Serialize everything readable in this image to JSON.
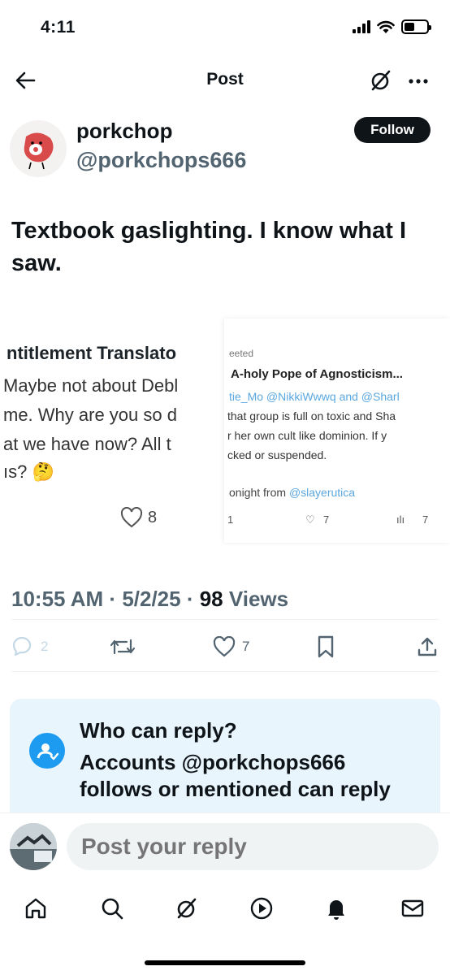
{
  "status_bar": {
    "time": "4:11"
  },
  "header": {
    "title": "Post"
  },
  "author": {
    "name": "porkchop",
    "handle": "@porkchops666",
    "follow_label": "Follow"
  },
  "tweet": {
    "text": "Textbook gaslighting. I know what I saw."
  },
  "media": {
    "left": {
      "line1": "ntitlement Translato",
      "line2": "Maybe not about Debl",
      "line3": "me. Why are you so d",
      "line4": "at we have now? All t",
      "line5": "ıs? 🤔",
      "like_count": "8"
    },
    "right": {
      "retweeted": "eeted",
      "name": "A-holy Pope of Agnosticism...",
      "mentions": "tie_Mo @NikkiWwwq and @Sharl",
      "line1": "that group is full on toxic and Sha",
      "line2": "r her own cult like dominion. If y",
      "line3": "cked or suspended.",
      "footer_prefix": "onight from ",
      "footer_handle": "@slayerutica",
      "reply_count": "1",
      "like_count": "7",
      "views_count": "7"
    }
  },
  "meta": {
    "time": "10:55 AM",
    "date": "5/2/25",
    "views_count": "98",
    "views_label": "Views"
  },
  "actions": {
    "replies": "2",
    "likes": "7"
  },
  "reply_box": {
    "title": "Who can reply?",
    "description": "Accounts @porkchops666 follows or mentioned can reply"
  },
  "composer": {
    "placeholder": "Post your reply"
  },
  "colors": {
    "accent": "#1d9bf0",
    "text": "#0f1419",
    "secondary": "#536471",
    "reply_box_bg": "#e8f5fd"
  }
}
